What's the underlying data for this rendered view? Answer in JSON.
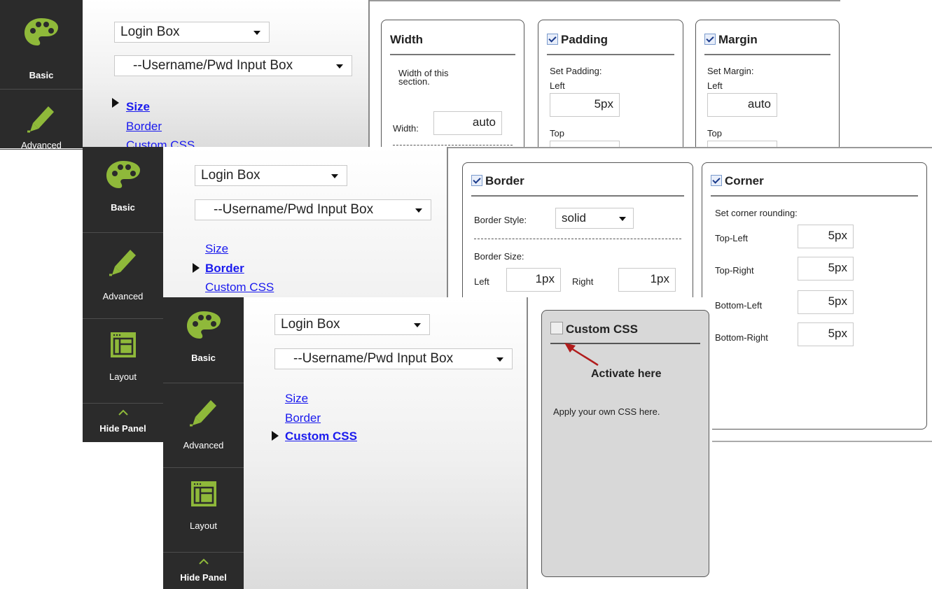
{
  "sidebar": {
    "basic_label": "Basic",
    "advanced_label": "Advanced",
    "layout_label": "Layout",
    "hide_label": "Hide Panel"
  },
  "selectors": {
    "element": "Login Box",
    "subelement": "--Username/Pwd Input Box"
  },
  "menu": {
    "size": "Size",
    "border": "Border",
    "custom_css": "Custom CSS"
  },
  "size_panel": {
    "width": {
      "title": "Width",
      "desc": "Width of this section.",
      "label": "Width:",
      "value": "auto"
    },
    "padding": {
      "title": "Padding",
      "set_label": "Set Padding:",
      "left_label": "Left",
      "left_value": "5px",
      "top_label": "Top"
    },
    "margin": {
      "title": "Margin",
      "set_label": "Set Margin:",
      "left_label": "Left",
      "left_value": "auto",
      "top_label": "Top"
    }
  },
  "border_panel": {
    "border": {
      "title": "Border",
      "style_label": "Border Style:",
      "style_value": "solid",
      "size_label": "Border Size:",
      "left_label": "Left",
      "left_value": "1px",
      "right_label": "Right",
      "right_value": "1px"
    },
    "corner": {
      "title": "Corner",
      "set_label": "Set corner rounding:",
      "top_left_label": "Top-Left",
      "top_left_value": "5px",
      "top_right_label": "Top-Right",
      "top_right_value": "5px",
      "bottom_left_label": "Bottom-Left",
      "bottom_left_value": "5px",
      "bottom_right_label": "Bottom-Right",
      "bottom_right_value": "5px"
    }
  },
  "custom_css_panel": {
    "title": "Custom CSS",
    "annotation": "Activate here",
    "desc": "Apply your own CSS here."
  },
  "colors": {
    "sidebar_bg": "#2b2b2b",
    "icon_green": "#8fb93a",
    "link_blue": "#1a1aee",
    "annotation_red": "#b11c1c"
  }
}
